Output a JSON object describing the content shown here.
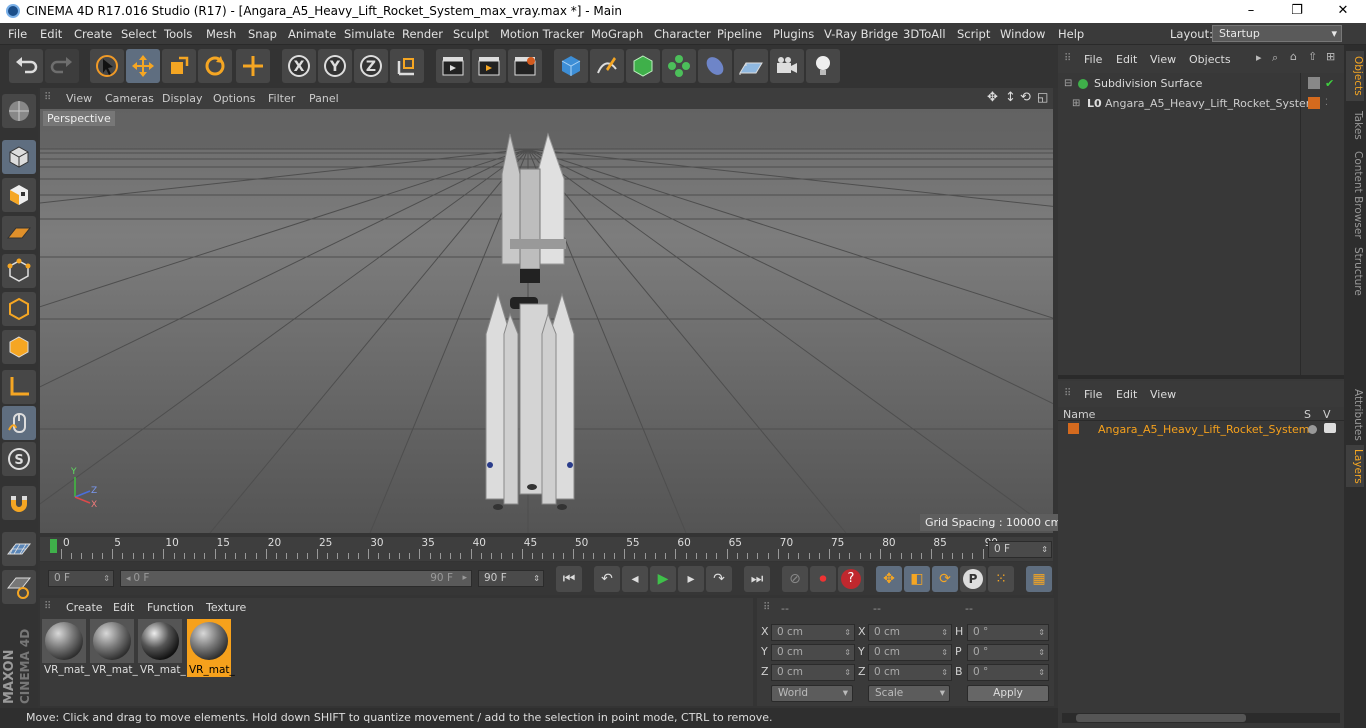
{
  "window": {
    "title": "CINEMA 4D R17.016 Studio (R17) - [Angara_A5_Heavy_Lift_Rocket_System_max_vray.max *] - Main",
    "minimize": "–",
    "maximize": "❐",
    "close": "✕"
  },
  "menu": [
    "File",
    "Edit",
    "Create",
    "Select",
    "Tools",
    "Mesh",
    "Snap",
    "Animate",
    "Simulate",
    "Render",
    "Sculpt",
    "Motion Tracker",
    "MoGraph",
    "Character",
    "Pipeline",
    "Plugins",
    "V-Ray Bridge",
    "3DToAll",
    "Script",
    "Window",
    "Help"
  ],
  "layout": {
    "label": "Layout:",
    "value": "Startup"
  },
  "viewport": {
    "menu": [
      "View",
      "Cameras",
      "Display",
      "Options",
      "Filter",
      "Panel"
    ],
    "camera": "Perspective",
    "grid_spacing": "Grid Spacing : 10000 cm",
    "axes": {
      "y": "Y",
      "z": "Z",
      "x": "X"
    }
  },
  "timeline": {
    "ticks": [
      "0",
      "5",
      "10",
      "15",
      "20",
      "25",
      "30",
      "35",
      "40",
      "45",
      "50",
      "55",
      "60",
      "65",
      "70",
      "75",
      "80",
      "85",
      "90"
    ],
    "current_frame": "0 F"
  },
  "transport": {
    "start": "0 F",
    "range_start": "0 F",
    "range_end": "90 F",
    "end": "90 F"
  },
  "materials": {
    "menu": [
      "Create",
      "Edit",
      "Function",
      "Texture"
    ],
    "items": [
      {
        "label": "VR_mat_"
      },
      {
        "label": "VR_mat_"
      },
      {
        "label": "VR_mat_"
      },
      {
        "label": "VR_mat_",
        "selected": true
      }
    ]
  },
  "coords": {
    "headers": [
      "--",
      "--",
      "--"
    ],
    "rows": [
      {
        "a": "X",
        "av": "0 cm",
        "b": "X",
        "bv": "0 cm",
        "c": "H",
        "cv": "0 °"
      },
      {
        "a": "Y",
        "av": "0 cm",
        "b": "Y",
        "bv": "0 cm",
        "c": "P",
        "cv": "0 °"
      },
      {
        "a": "Z",
        "av": "0 cm",
        "b": "Z",
        "bv": "0 cm",
        "c": "B",
        "cv": "0 °"
      }
    ],
    "world": "World",
    "scale": "Scale",
    "apply": "Apply"
  },
  "status": "Move: Click and drag to move elements. Hold down SHIFT to quantize movement / add to the selection in point mode, CTRL to remove.",
  "objects": {
    "menu": [
      "File",
      "Edit",
      "View",
      "Objects"
    ],
    "items": [
      {
        "name": "Subdivision Surface"
      },
      {
        "name": "Angara_A5_Heavy_Lift_Rocket_System"
      }
    ]
  },
  "layers": {
    "menu": [
      "File",
      "Edit",
      "View"
    ],
    "col_name": "Name",
    "col_s": "S",
    "col_v": "V",
    "items": [
      {
        "name": "Angara_A5_Heavy_Lift_Rocket_System"
      }
    ]
  },
  "side_tabs": [
    "Objects",
    "Takes",
    "Content Browser",
    "Structure",
    "Attributes",
    "Layers"
  ],
  "brand": {
    "maxon": "MAXON",
    "c4d": "CINEMA 4D"
  },
  "colors": {
    "accent": "#f6a11c",
    "active_tool": "#5f6e80",
    "layer_color": "#d46a1e"
  }
}
